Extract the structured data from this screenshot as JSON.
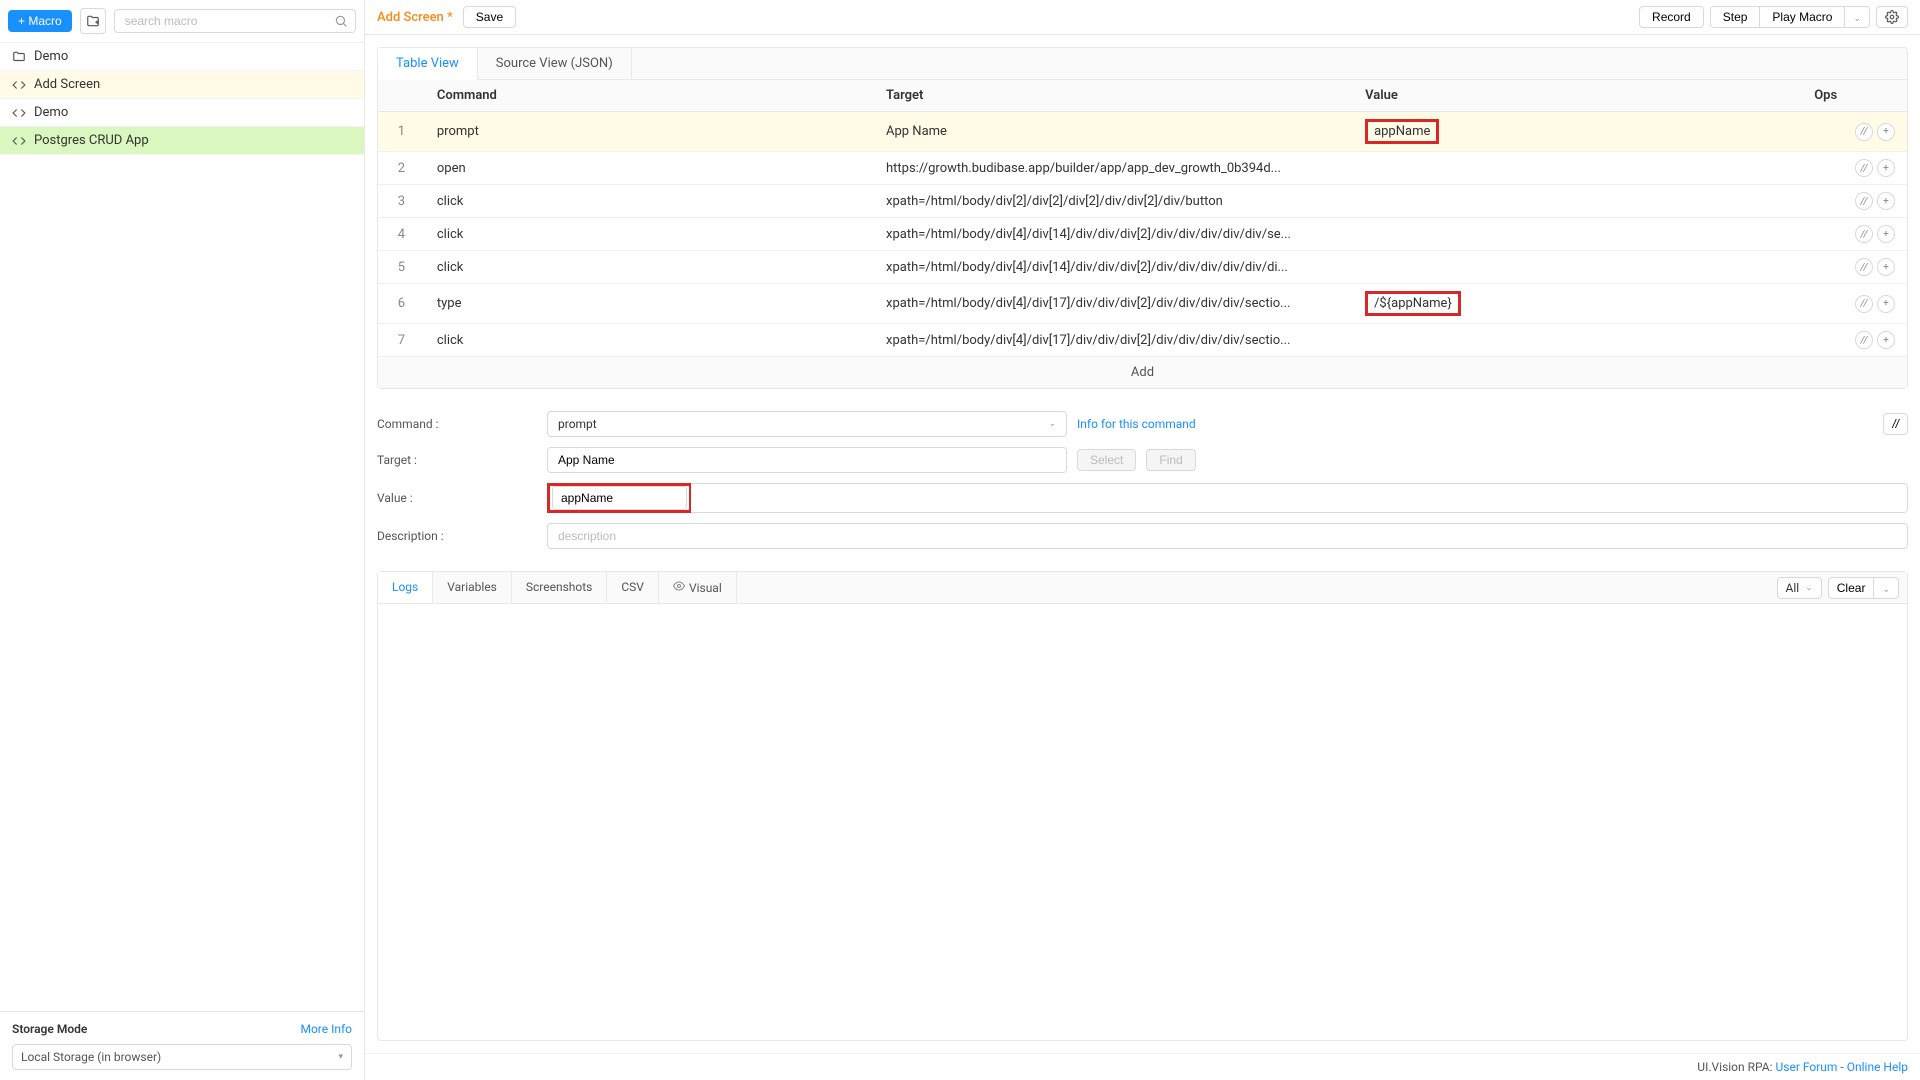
{
  "sidebar": {
    "addMacroLabel": "+ Macro",
    "searchPlaceholder": "search macro",
    "items": [
      {
        "label": "Demo",
        "type": "folder",
        "highlight": ""
      },
      {
        "label": "Add Screen",
        "type": "macro",
        "highlight": "yellow"
      },
      {
        "label": "Demo",
        "type": "macro",
        "highlight": ""
      },
      {
        "label": "Postgres CRUD App",
        "type": "macro",
        "highlight": "green"
      }
    ],
    "storageTitle": "Storage Mode",
    "moreInfoLabel": "More Info",
    "storageValue": "Local Storage (in browser)"
  },
  "topbar": {
    "title": "Add Screen *",
    "saveLabel": "Save",
    "recordLabel": "Record",
    "stepLabel": "Step",
    "playMacroLabel": "Play Macro"
  },
  "tabs": {
    "tableView": "Table View",
    "sourceView": "Source View (JSON)"
  },
  "tableHeaders": {
    "command": "Command",
    "target": "Target",
    "value": "Value",
    "ops": "Ops"
  },
  "rows": [
    {
      "n": "1",
      "cmd": "prompt",
      "target": "App Name",
      "value": "appName",
      "selected": true,
      "redboxValue": true
    },
    {
      "n": "2",
      "cmd": "open",
      "target": "https://growth.budibase.app/builder/app/app_dev_growth_0b394d...",
      "value": ""
    },
    {
      "n": "3",
      "cmd": "click",
      "target": "xpath=/html/body/div[2]/div[2]/div[2]/div/div[2]/div/button",
      "value": ""
    },
    {
      "n": "4",
      "cmd": "click",
      "target": "xpath=/html/body/div[4]/div[14]/div/div/div[2]/div/div/div/div/div/se...",
      "value": ""
    },
    {
      "n": "5",
      "cmd": "click",
      "target": "xpath=/html/body/div[4]/div[14]/div/div/div[2]/div/div/div/div/div/di...",
      "value": ""
    },
    {
      "n": "6",
      "cmd": "type",
      "target": "xpath=/html/body/div[4]/div[17]/div/div/div[2]/div/div/div/div/sectio...",
      "value": "/${appName}",
      "redboxValue": true
    },
    {
      "n": "7",
      "cmd": "click",
      "target": "xpath=/html/body/div[4]/div[17]/div/div/div[2]/div/div/div/div/sectio...",
      "value": ""
    }
  ],
  "addLabel": "Add",
  "editor": {
    "commandLabel": "Command :",
    "commandValue": "prompt",
    "infoLabel": "Info for this command",
    "targetLabel": "Target :",
    "targetValue": "App Name",
    "selectLabel": "Select",
    "findLabel": "Find",
    "valueLabel": "Value :",
    "valueValue": "appName",
    "descLabel": "Description :",
    "descPlaceholder": "description"
  },
  "logs": {
    "tabs": [
      "Logs",
      "Variables",
      "Screenshots",
      "CSV",
      "Visual"
    ],
    "filterLabel": "All",
    "clearLabel": "Clear"
  },
  "footer": {
    "prefix": "UI.Vision RPA: ",
    "userForum": "User Forum",
    "sep": " - ",
    "onlineHelp": "Online Help"
  }
}
